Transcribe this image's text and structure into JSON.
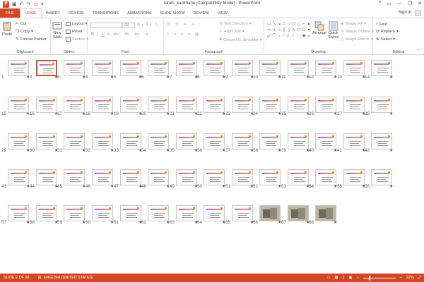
{
  "window": {
    "title": "tarahi_karikhane [Compatibility Mode] - PowerPoint",
    "app_icon": "P",
    "controls": [
      "?",
      "▭",
      "—",
      "❐",
      "✕"
    ]
  },
  "tabs": [
    "FILE",
    "HOME",
    "INSERT",
    "DESIGN",
    "TRANSITIONS",
    "ANIMATIONS",
    "SLIDE SHOW",
    "REVIEW",
    "VIEW"
  ],
  "active_tab": "HOME",
  "account": {
    "sign_in": "Sign in"
  },
  "ribbon": {
    "clipboard": {
      "label": "Clipboard",
      "paste": "Paste",
      "cut": "Cut",
      "copy": "Copy",
      "format_painter": "Format Painter"
    },
    "slides": {
      "label": "Slides",
      "new_slide": "New",
      "new_slide2": "Slide",
      "layout": "Layout",
      "reset": "Reset",
      "section": "Section"
    },
    "font": {
      "label": "Font",
      "size": "28"
    },
    "paragraph": {
      "label": "Paragraph",
      "text_direction": "Text Direction",
      "align_text": "Align Text",
      "convert_smartart": "Convert to SmartArt"
    },
    "drawing": {
      "label": "Drawing",
      "arrange": "Arrange",
      "quick_styles": "Quick",
      "quick_styles2": "Styles",
      "shape_fill": "Shape Fill",
      "shape_outline": "Shape Outline",
      "shape_effects": "Shape Effects"
    },
    "editing": {
      "label": "Editing",
      "find": "Find",
      "replace": "Replace",
      "select": "Select"
    }
  },
  "slides": {
    "selected": 2,
    "photo_slides": [
      66,
      67,
      68
    ],
    "star": "★",
    "numbers": [
      "1",
      "2",
      "3",
      "4",
      "5",
      "6",
      "7",
      "8",
      "9",
      "10",
      "11",
      "12",
      "13",
      "14",
      "15",
      "16",
      "17",
      "18",
      "19",
      "20",
      "21",
      "22",
      "23",
      "24",
      "25",
      "26",
      "27",
      "28",
      "29",
      "30",
      "31",
      "32",
      "33",
      "34",
      "35",
      "36",
      "37",
      "38",
      "39",
      "40",
      "41",
      "42",
      "43",
      "44",
      "45",
      "46",
      "47",
      "48",
      "49",
      "50",
      "51",
      "52",
      "53",
      "54",
      "55",
      "56",
      "57",
      "58",
      "59",
      "60",
      "61",
      "62",
      "63",
      "64",
      "65",
      "66",
      "67",
      "68"
    ]
  },
  "status": {
    "slide_info": "SLIDE 2 OF 68",
    "language": "ENGLISH (UNITED STATES)",
    "zoom": "22%"
  },
  "colors": {
    "accent": "#d24726",
    "selected_border": "#c55a3b"
  }
}
